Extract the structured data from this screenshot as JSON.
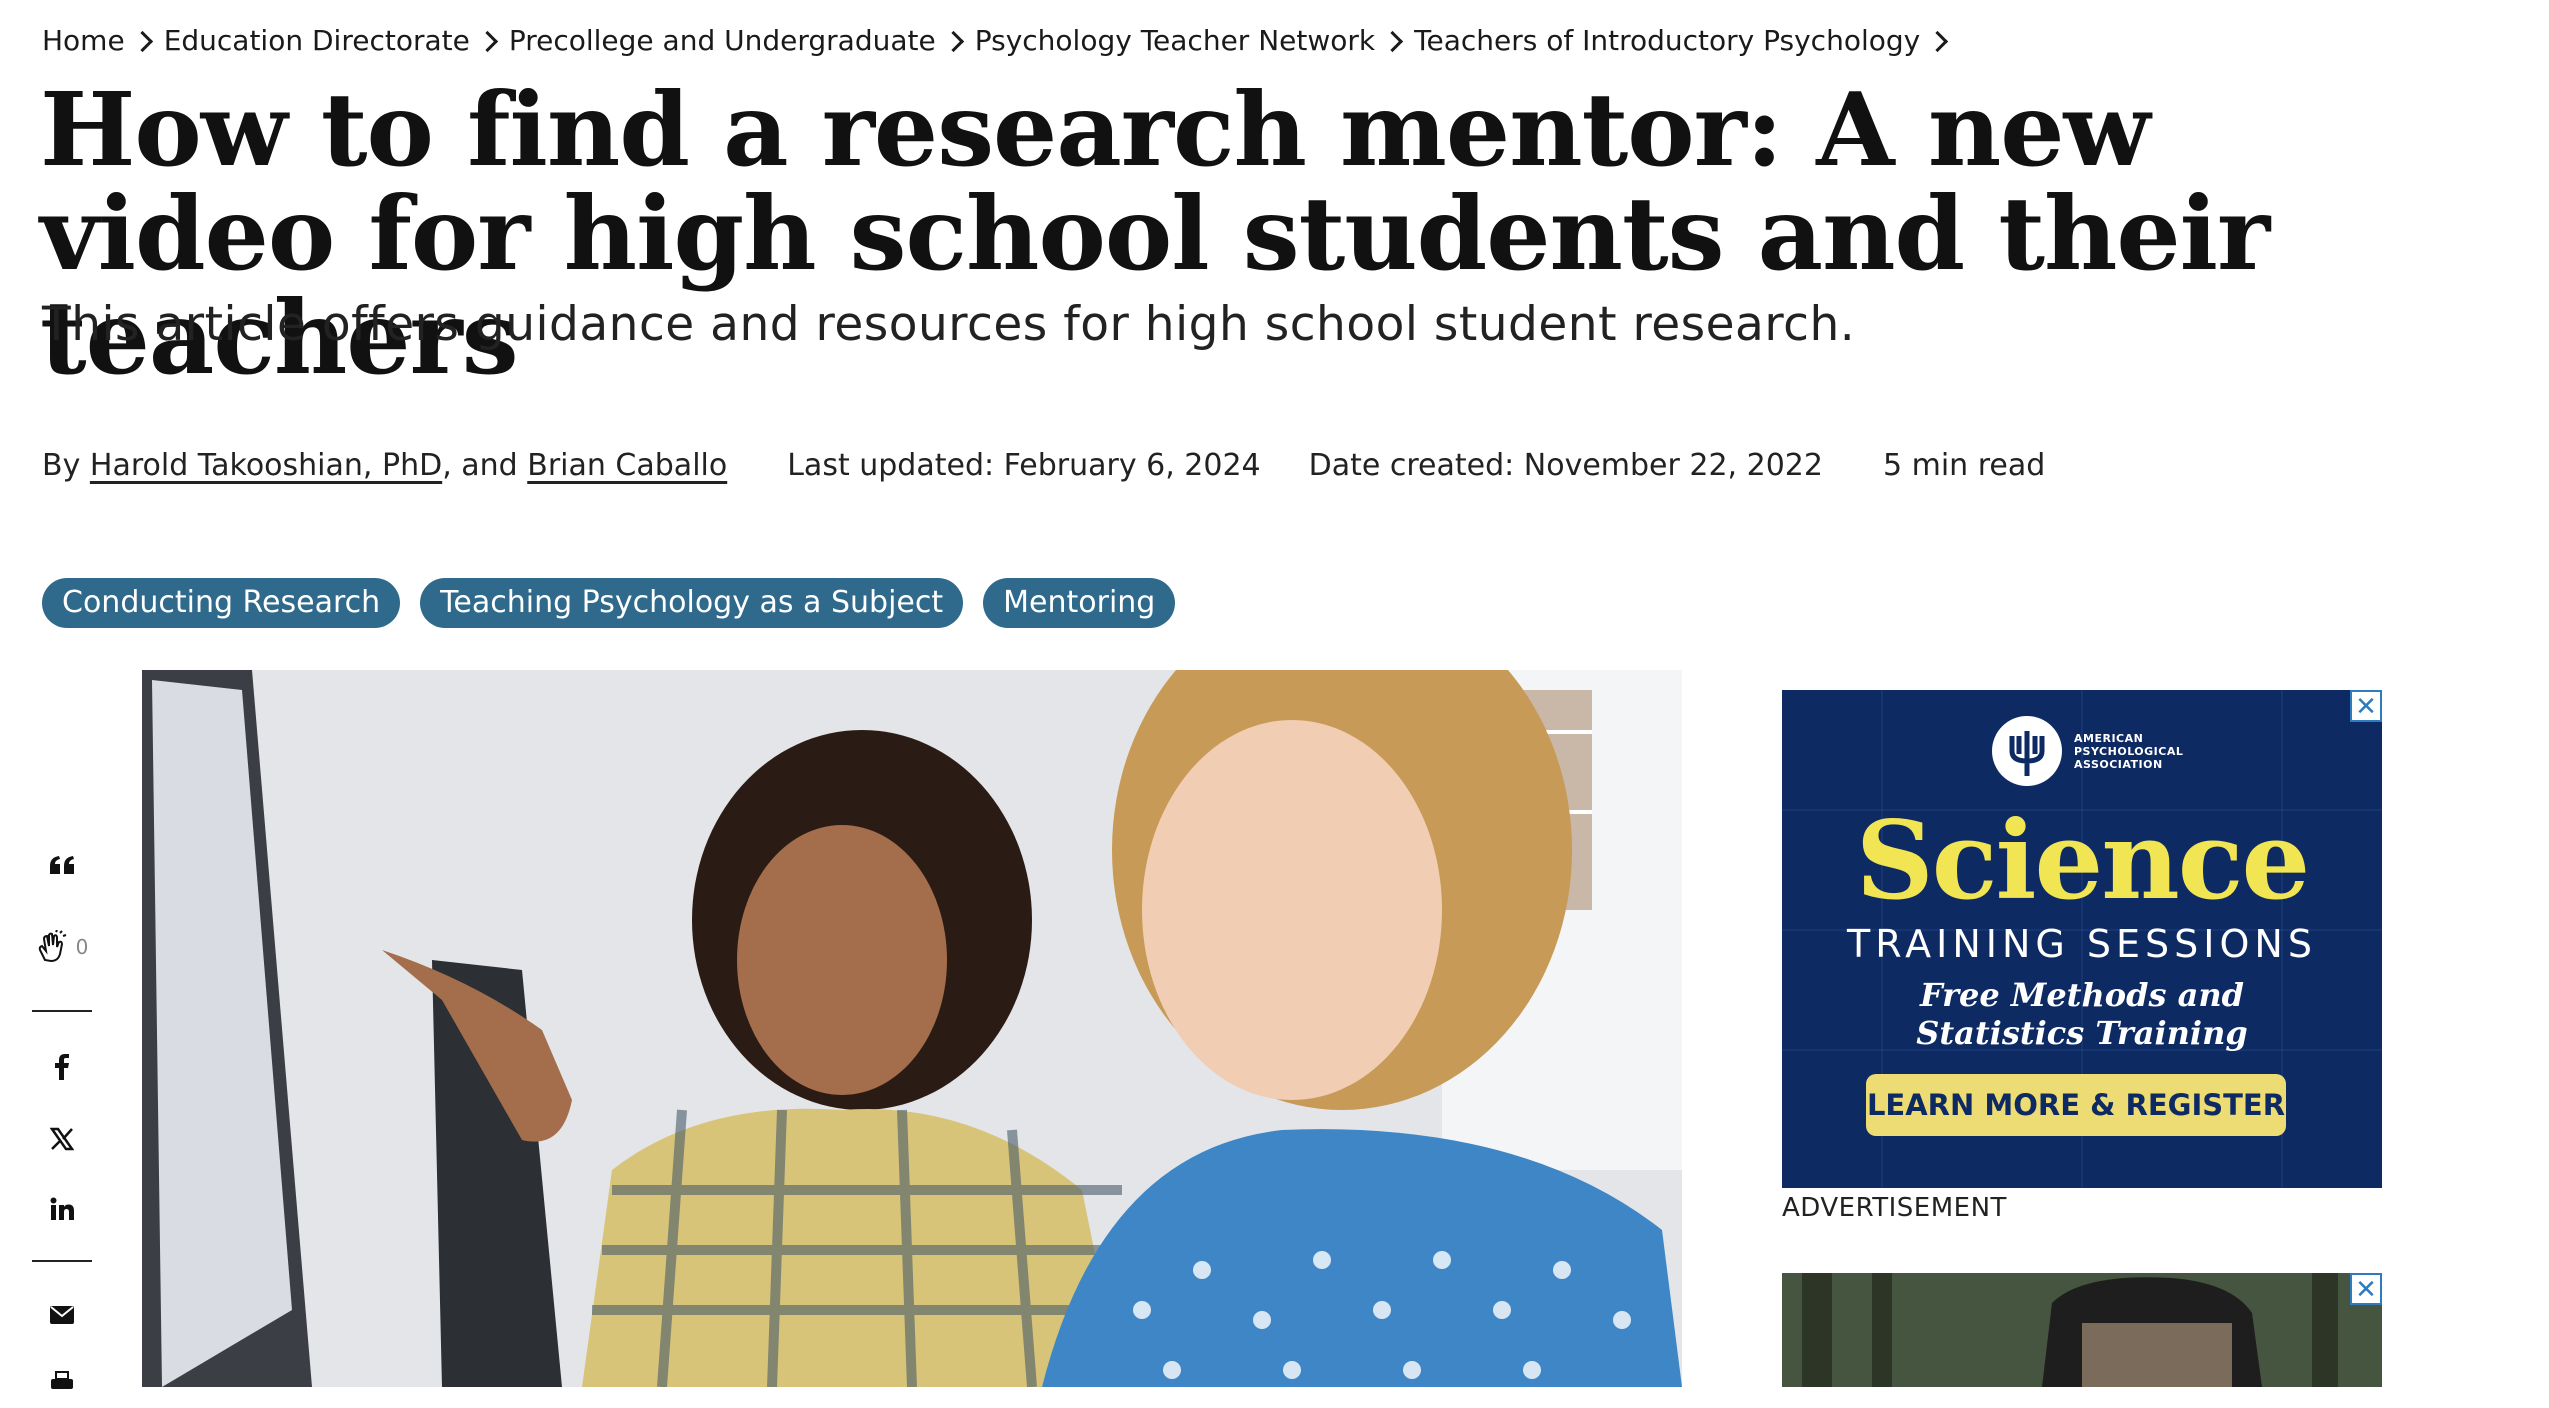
{
  "breadcrumb": [
    "Home",
    "Education Directorate",
    "Precollege and Undergraduate",
    "Psychology Teacher Network",
    "Teachers of Introductory Psychology"
  ],
  "article": {
    "title": "How to find a research mentor: A new video for high school students and their teachers",
    "subtitle": "This article offers guidance and resources for high school student research.",
    "by_prefix": "By",
    "author1": "Harold Takooshian, PhD",
    "author_joiner": ", and",
    "author2": "Brian Caballo",
    "last_updated": "Last updated: February 6, 2024",
    "date_created": "Date created: November 22, 2022",
    "read_time": "5 min read"
  },
  "tags": [
    "Conducting Research",
    "Teaching Psychology as a Subject",
    "Mentoring"
  ],
  "share": {
    "quote_icon": "quote-icon",
    "clap_icon": "clap-icon",
    "clap_count": "0",
    "icons": [
      "facebook-icon",
      "x-icon",
      "linkedin-icon",
      "email-icon",
      "print-icon"
    ]
  },
  "ad": {
    "org": "AMERICAN PSYCHOLOGICAL ASSOCIATION",
    "heading": "Science",
    "sub": "TRAINING SESSIONS",
    "tagline_line1": "Free Methods and",
    "tagline_line2": "Statistics Training",
    "cta": "LEARN MORE & REGISTER",
    "label": "ADVERTISEMENT",
    "close_symbol": "✕"
  }
}
